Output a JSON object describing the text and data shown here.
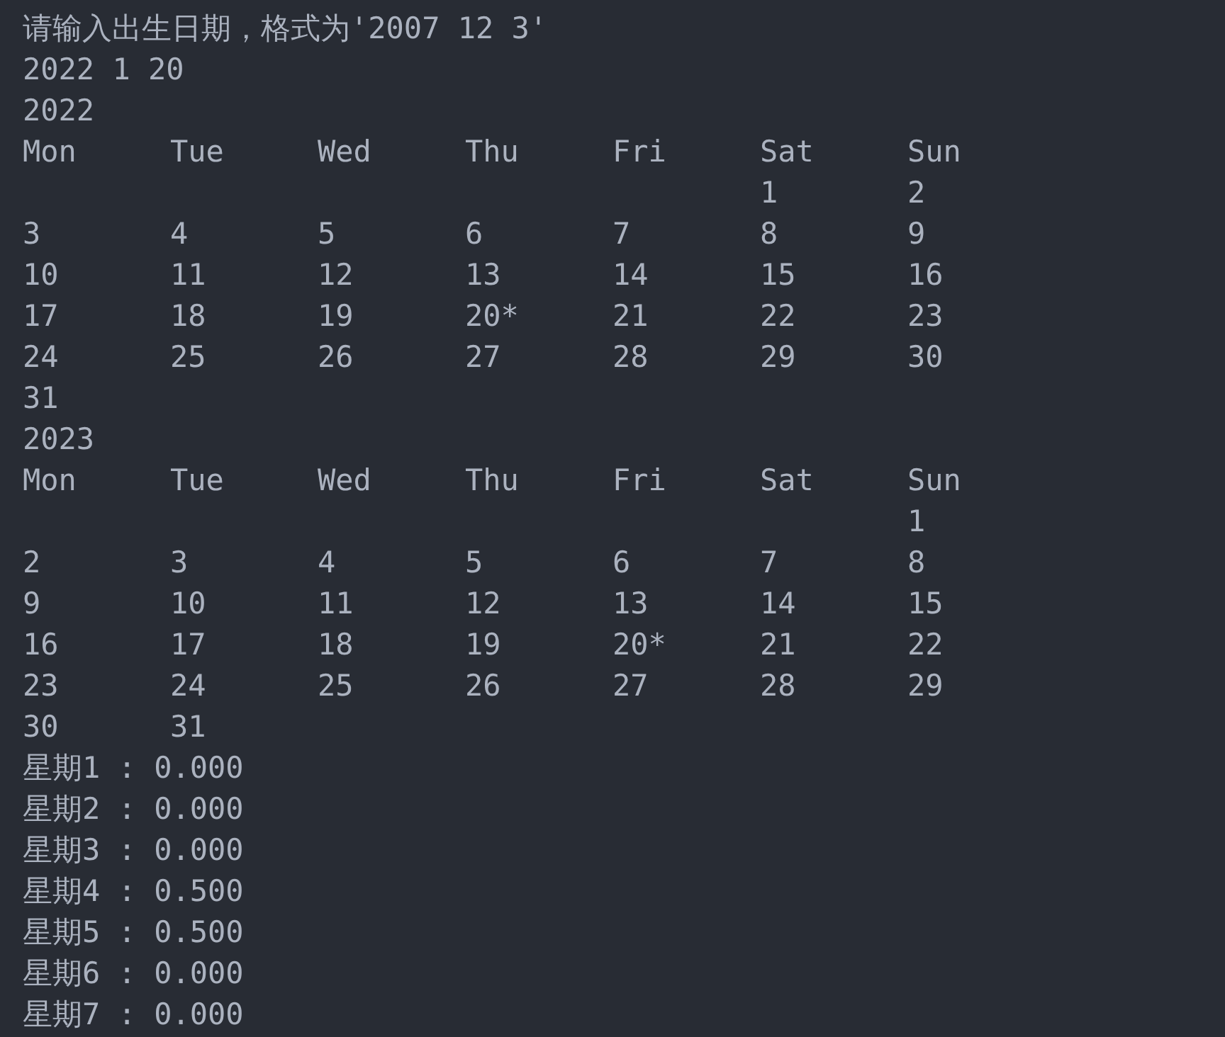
{
  "prompt": "请输入出生日期，格式为'2007 12 3'",
  "input": "2022 1 20",
  "calendars": [
    {
      "year": "2022",
      "headers": [
        "Mon",
        "Tue",
        "Wed",
        "Thu",
        "Fri",
        "Sat",
        "Sun"
      ],
      "weeks": [
        {
          "kind": "first",
          "days": [
            "1",
            "2"
          ]
        },
        {
          "kind": "full",
          "days": [
            "3",
            "4",
            "5",
            "6",
            "7",
            "8",
            "9"
          ]
        },
        {
          "kind": "full",
          "days": [
            "10",
            "11",
            "12",
            "13",
            "14",
            "15",
            "16"
          ]
        },
        {
          "kind": "full",
          "days": [
            "17",
            "18",
            "19",
            "20*",
            "21",
            "22",
            "23"
          ]
        },
        {
          "kind": "full",
          "days": [
            "24",
            "25",
            "26",
            "27",
            "28",
            "29",
            "30"
          ]
        },
        {
          "kind": "last",
          "days": [
            "31"
          ]
        }
      ]
    },
    {
      "year": "2023",
      "headers": [
        "Mon",
        "Tue",
        "Wed",
        "Thu",
        "Fri",
        "Sat",
        "Sun"
      ],
      "weeks": [
        {
          "kind": "first",
          "days": [
            "1"
          ]
        },
        {
          "kind": "full",
          "days": [
            "2",
            "3",
            "4",
            "5",
            "6",
            "7",
            "8"
          ]
        },
        {
          "kind": "full",
          "days": [
            "9",
            "10",
            "11",
            "12",
            "13",
            "14",
            "15"
          ]
        },
        {
          "kind": "full",
          "days": [
            "16",
            "17",
            "18",
            "19",
            "20*",
            "21",
            "22"
          ]
        },
        {
          "kind": "full",
          "days": [
            "23",
            "24",
            "25",
            "26",
            "27",
            "28",
            "29"
          ]
        },
        {
          "kind": "last",
          "days": [
            "30",
            "31"
          ]
        }
      ]
    }
  ],
  "stats": [
    "星期1 : 0.000",
    "星期2 : 0.000",
    "星期3 : 0.000",
    "星期4 : 0.500",
    "星期5 : 0.500",
    "星期6 : 0.000",
    "星期7 : 0.000"
  ]
}
